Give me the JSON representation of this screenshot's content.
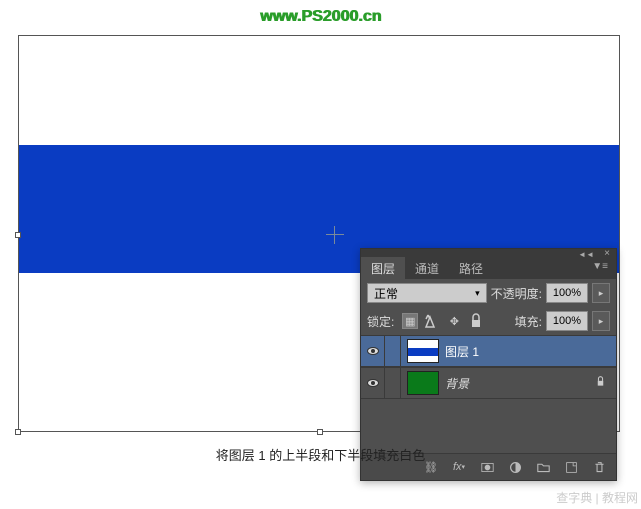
{
  "header": {
    "url": "www.PS2000.cn"
  },
  "panel": {
    "tabs": [
      {
        "label": "图层",
        "active": true
      },
      {
        "label": "通道",
        "active": false
      },
      {
        "label": "路径",
        "active": false
      }
    ],
    "blend_mode": "正常",
    "opacity_label": "不透明度:",
    "opacity_value": "100%",
    "lock_label": "锁定:",
    "fill_label": "填充:",
    "fill_value": "100%",
    "layers": [
      {
        "name": "图层 1",
        "selected": true,
        "locked": false,
        "thumb": "blue-band"
      },
      {
        "name": "背景",
        "selected": false,
        "locked": true,
        "thumb": "green",
        "italic": true
      }
    ]
  },
  "caption": "将图层 1 的上半段和下半段填充白色",
  "watermark": "查字典 | 教程网"
}
